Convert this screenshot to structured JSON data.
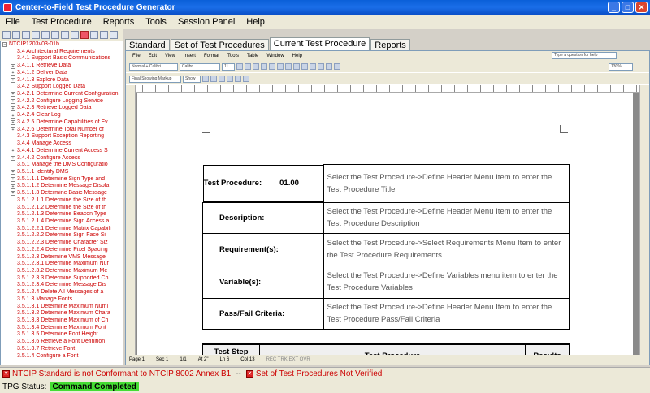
{
  "window": {
    "title": "Center-to-Field Test Procedure Generator"
  },
  "menu": {
    "items": [
      "File",
      "Test Procedure",
      "Reports",
      "Tools",
      "Session Panel",
      "Help"
    ]
  },
  "tree": {
    "root": "NTCIP1203v03-01b",
    "items": [
      {
        "text": "3.4 Architectural Requirements",
        "exp": false
      },
      {
        "text": "3.4.1 Support Basic Communications",
        "exp": false
      },
      {
        "text": "3.4.1.1 Retrieve Data",
        "exp": true
      },
      {
        "text": "3.4.1.2 Deliver Data",
        "exp": true
      },
      {
        "text": "3.4.1.3 Explore Data",
        "exp": true
      },
      {
        "text": "3.4.2 Support Logged Data",
        "exp": false
      },
      {
        "text": "3.4.2.1 Determine Current Configuration",
        "exp": true
      },
      {
        "text": "3.4.2.2 Configure Logging Service",
        "exp": true
      },
      {
        "text": "3.4.2.3 Retrieve Logged Data",
        "exp": true
      },
      {
        "text": "3.4.2.4 Clear Log",
        "exp": true
      },
      {
        "text": "3.4.2.5 Determine Capabilities of Ev",
        "exp": true
      },
      {
        "text": "3.4.2.6 Determine Total Number of",
        "exp": true
      },
      {
        "text": "3.4.3 Support Exception Reporting",
        "exp": false
      },
      {
        "text": "3.4.4 Manage Access",
        "exp": false
      },
      {
        "text": "3.4.4.1 Determine Current Access S",
        "exp": true
      },
      {
        "text": "3.4.4.2 Configure Access",
        "exp": true
      },
      {
        "text": "3.5.1 Manage the DMS Configuratio",
        "exp": false
      },
      {
        "text": "3.5.1.1 Identify DMS",
        "exp": true
      },
      {
        "text": "3.5.1.1.1 Determine Sign Type and",
        "exp": true
      },
      {
        "text": "3.5.1.1.2 Determine Message Displa",
        "exp": true
      },
      {
        "text": "3.5.1.1.3 Determine Basic Message",
        "exp": true
      },
      {
        "text": "3.5.1.2.1.1 Determine the Size of th",
        "exp": false
      },
      {
        "text": "3.5.1.2.1.2 Determine the Size of th",
        "exp": false
      },
      {
        "text": "3.5.1.2.1.3 Determine Beacon Type",
        "exp": false
      },
      {
        "text": "3.5.1.2.1.4 Determine Sign Access a",
        "exp": false
      },
      {
        "text": "3.5.1.2.2.1 Determine Matrix Capabili",
        "exp": false
      },
      {
        "text": "3.5.1.2.2.2 Determine Sign Face Si",
        "exp": false
      },
      {
        "text": "3.5.1.2.2.3 Determine Character Siz",
        "exp": false
      },
      {
        "text": "3.5.1.2.2.4 Determine Pixel Spacing",
        "exp": false
      },
      {
        "text": "3.5.1.2.3 Determine VMS Message",
        "exp": false
      },
      {
        "text": "3.5.1.2.3.1 Determine Maximum Nur",
        "exp": false
      },
      {
        "text": "3.5.1.2.3.2 Determine Maximum Me",
        "exp": false
      },
      {
        "text": "3.5.1.2.3.3 Determine Supported Ch",
        "exp": false
      },
      {
        "text": "3.5.1.2.3.4 Determine Message Dis",
        "exp": false
      },
      {
        "text": "3.5.1.2.4 Delete All Messages of a",
        "exp": false
      },
      {
        "text": "3.5.1.3 Manage Fonts",
        "exp": false
      },
      {
        "text": "3.5.1.3.1 Determine Maximum Numl",
        "exp": false
      },
      {
        "text": "3.5.1.3.2 Determine Maximum Chara",
        "exp": false
      },
      {
        "text": "3.5.1.3.3 Determine Maximum of Ch",
        "exp": false
      },
      {
        "text": "3.5.1.3.4 Determine Maximum Font",
        "exp": false
      },
      {
        "text": "3.5.1.3.5 Determine Font Height",
        "exp": false
      },
      {
        "text": "3.5.1.3.6 Retrieve a Font Definition",
        "exp": false
      },
      {
        "text": "3.5.1.3.7 Retrieve Font",
        "exp": false
      },
      {
        "text": "3.5.1.4 Configure a Font",
        "exp": false
      }
    ]
  },
  "tabs": [
    {
      "label": "Standard",
      "active": false
    },
    {
      "label": "Set of Test Procedures",
      "active": false
    },
    {
      "label": "Current Test Procedure",
      "active": true
    },
    {
      "label": "Reports",
      "active": false
    }
  ],
  "word": {
    "menu": [
      "File",
      "Edit",
      "View",
      "Insert",
      "Format",
      "Tools",
      "Table",
      "Window",
      "Help"
    ],
    "help_placeholder": "Type a question for help",
    "style": "Normal + Calibri",
    "font": "Calibri",
    "size": "11",
    "zoom": "130%",
    "markup": "Final Showing Markup",
    "show": "Show",
    "status": {
      "page": "Page 1",
      "sec": "Sec 1",
      "of": "1/1",
      "at": "At 2\"",
      "ln": "Ln 6",
      "col": "Col 13",
      "flags": "REC  TRK  EXT  OVR"
    }
  },
  "procedure": {
    "header_label": "Test Procedure:",
    "number": "01.00",
    "header_value": "Select the Test Procedure->Define Header Menu Item to enter the Test Procedure Title",
    "rows": [
      {
        "label": "Description:",
        "value": "Select the Test Procedure->Define Header Menu Item to enter the Test Procedure Description"
      },
      {
        "label": "Requirement(s):",
        "value": "Select the Test Procedure->Select Requirements Menu Item to enter the Test Procedure Requirements"
      },
      {
        "label": "Variable(s):",
        "value": "Select the Test Procedure->Define Variables menu item to enter the Test Procedure Variables"
      },
      {
        "label": "Pass/Fail Criteria:",
        "value": "Select the Test Procedure->Define Header Menu Item to enter the Test Procedure Pass/Fail Criteria"
      }
    ],
    "step_header": "Test Step",
    "proc_header": "Test Procedure",
    "results_header": "Results"
  },
  "errors": {
    "left": "NTCIP Standard is not Conformant to NTCIP 8002 Annex B1",
    "right": "Set of Test Procedures Not Verified"
  },
  "status": {
    "label": "TPG Status:",
    "value": "Command Completed"
  }
}
